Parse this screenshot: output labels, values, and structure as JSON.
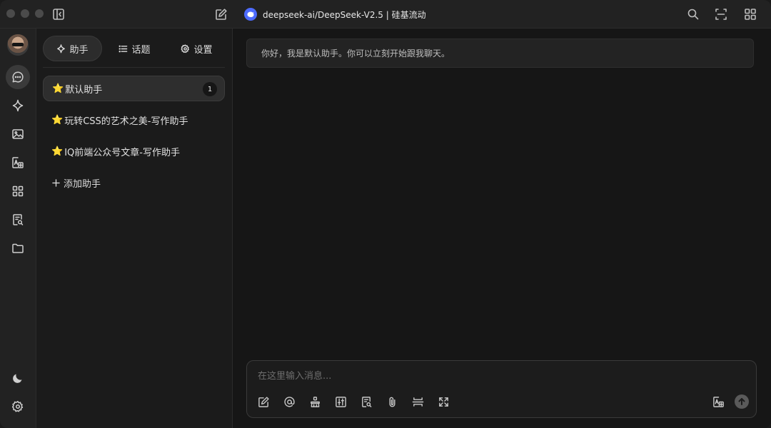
{
  "titlebar": {
    "model_title": "deepseek-ai/DeepSeek-V2.5 | 硅基流动",
    "icons": [
      "sidebar-toggle-icon",
      "new-chat-icon",
      "deepseek-logo-icon",
      "search-icon",
      "layout-icon",
      "apps-grid-icon"
    ]
  },
  "rail": {
    "items": [
      {
        "name": "chat",
        "icon": "chat-bubble-icon"
      },
      {
        "name": "agents",
        "icon": "sparkle-icon"
      },
      {
        "name": "painting",
        "icon": "image-icon"
      },
      {
        "name": "translate",
        "icon": "translate-icon"
      },
      {
        "name": "apps",
        "icon": "apps-grid-icon"
      },
      {
        "name": "knowledge",
        "icon": "document-search-icon"
      },
      {
        "name": "files",
        "icon": "folder-icon"
      }
    ],
    "bottom": [
      {
        "name": "theme",
        "icon": "moon-icon"
      },
      {
        "name": "settings",
        "icon": "gear-icon"
      }
    ]
  },
  "panel": {
    "tabs": [
      {
        "label": "助手",
        "icon": "sparkle-icon",
        "active": true
      },
      {
        "label": "话题",
        "icon": "list-icon",
        "active": false
      },
      {
        "label": "设置",
        "icon": "gear-icon",
        "active": false
      }
    ],
    "assistants": [
      {
        "label": "默认助手",
        "badge": "1",
        "active": true
      },
      {
        "label": "玩转CSS的艺术之美-写作助手",
        "badge": "",
        "active": false
      },
      {
        "label": "IQ前端公众号文章-写作助手",
        "badge": "",
        "active": false
      }
    ],
    "add_label": "添加助手",
    "star_glyph": "⭐"
  },
  "chat": {
    "greeting": "你好，我是默认助手。你可以立刻开始跟我聊天。",
    "input_placeholder": "在这里输入消息...",
    "tools": [
      "edit-icon",
      "at-mention-icon",
      "clear-broom-icon",
      "adjust-settings-icon",
      "knowledge-base-icon",
      "attachment-icon",
      "divider-icon",
      "expand-icon"
    ],
    "right_tools": [
      "translate-icon",
      "send-icon"
    ]
  },
  "colors": {
    "background": "#161616",
    "panel": "#1b1b1b",
    "accent_logo": "#4d6bfe",
    "star": "#f5c84b"
  }
}
